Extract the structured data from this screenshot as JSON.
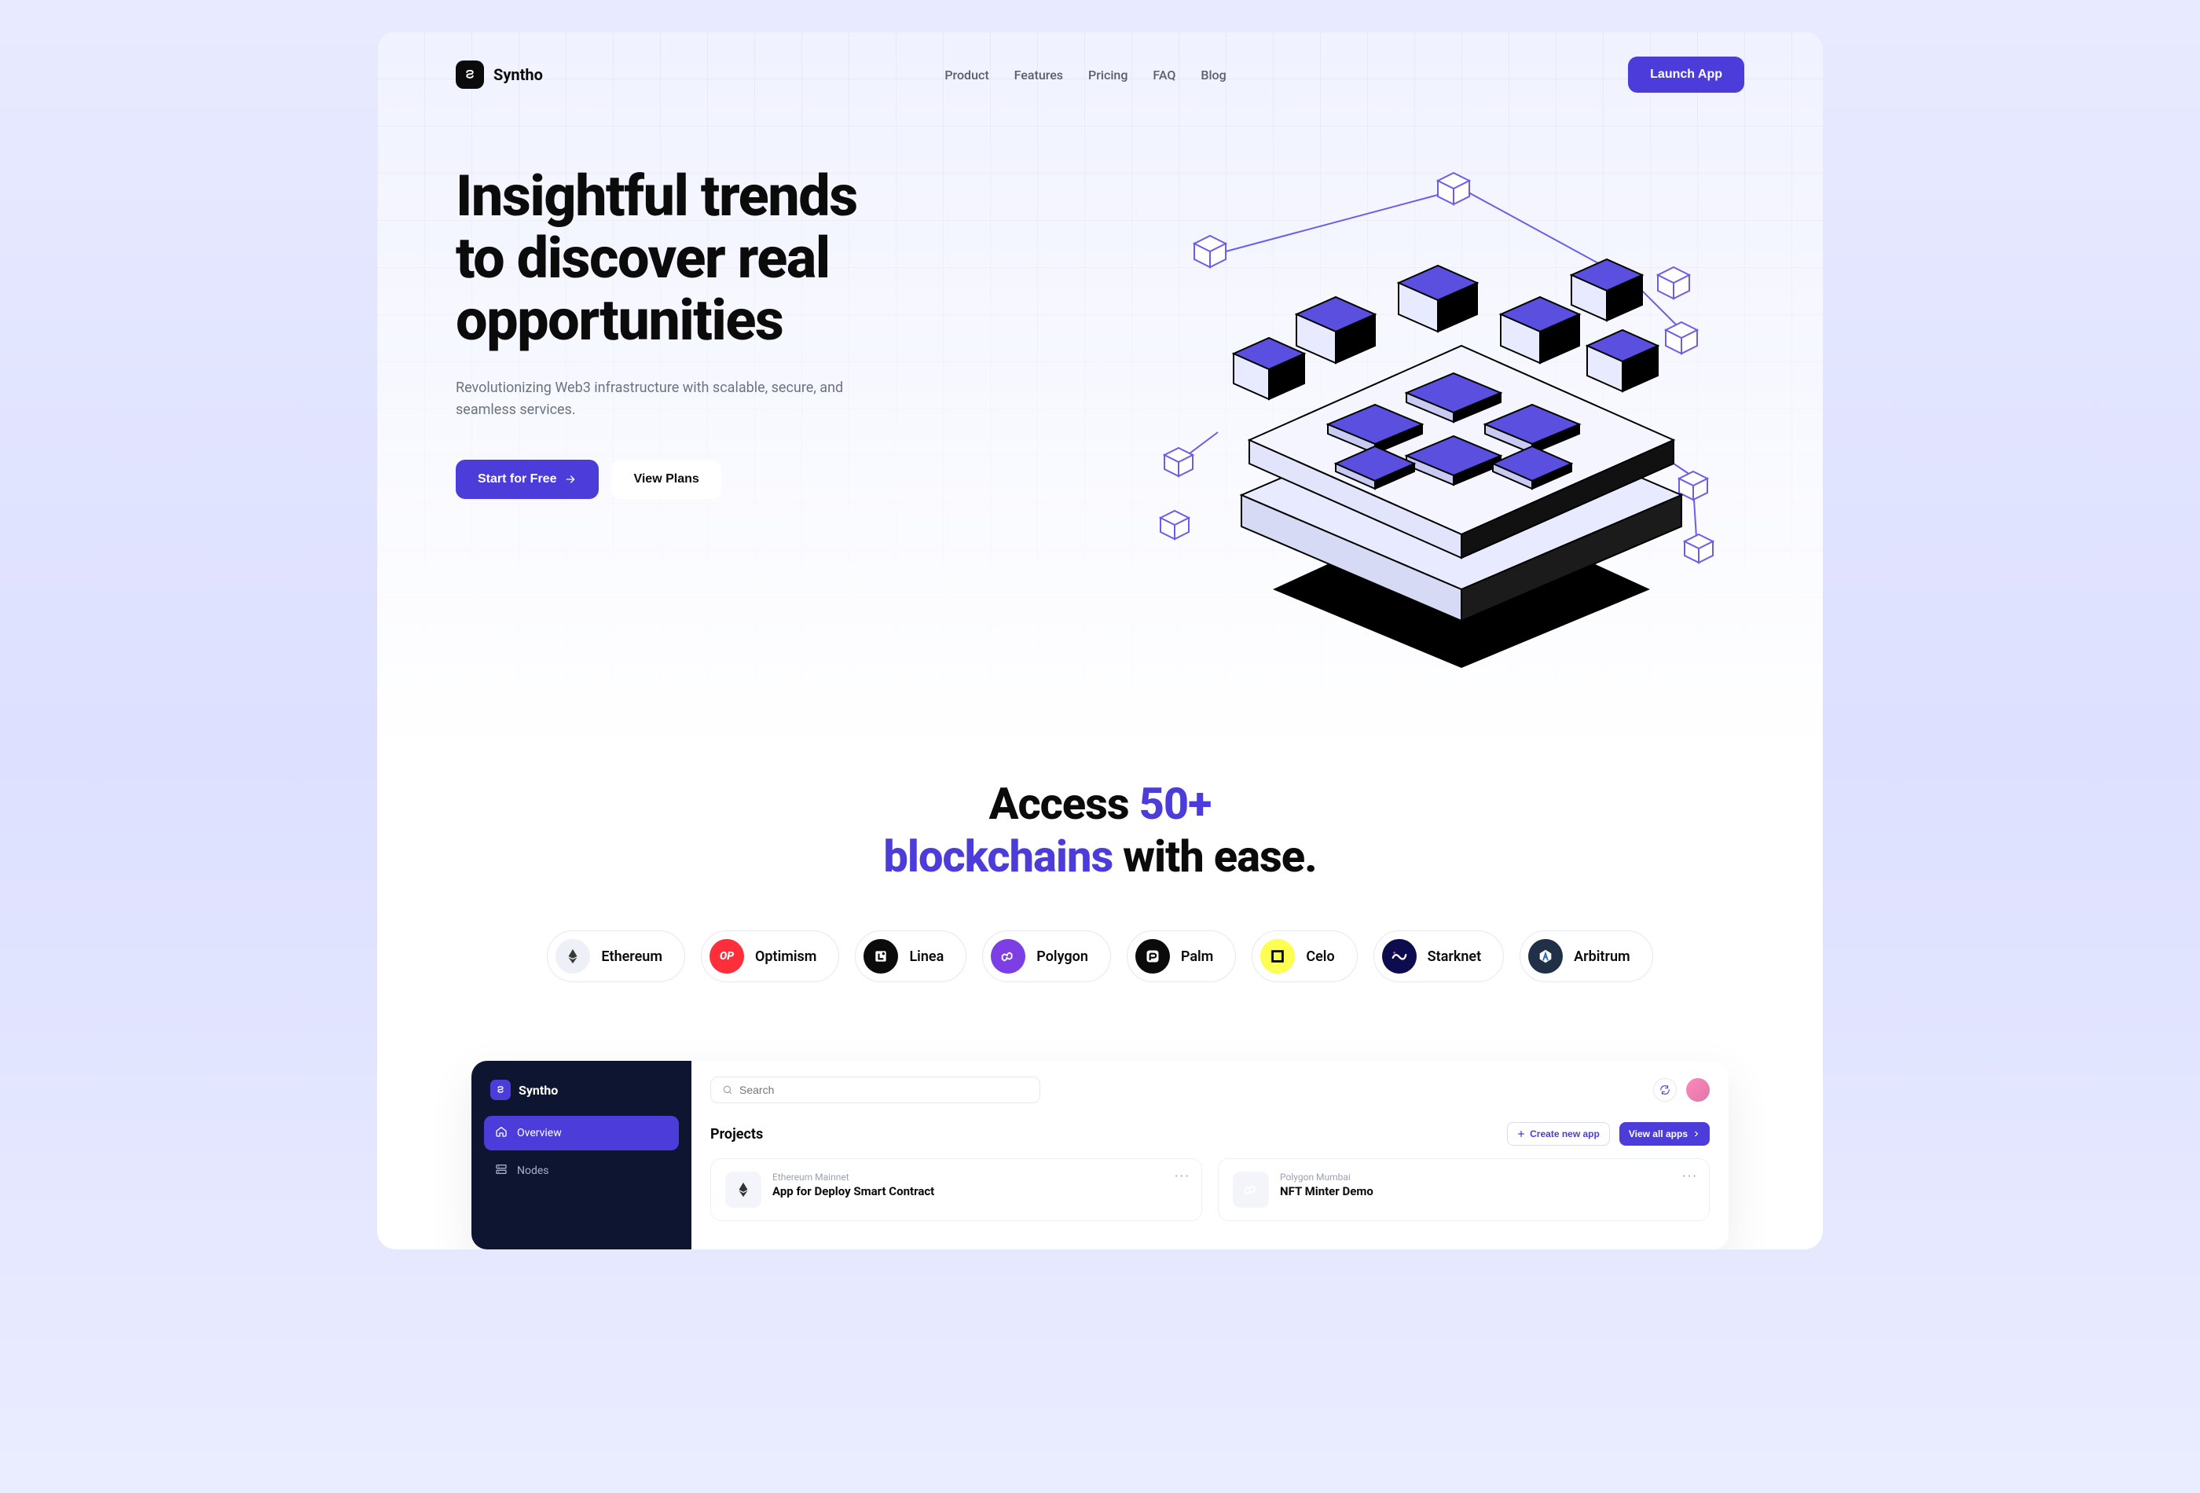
{
  "brand": {
    "name": "Syntho"
  },
  "nav": {
    "items": [
      "Product",
      "Features",
      "Pricing",
      "FAQ",
      "Blog"
    ]
  },
  "header": {
    "launch": "Launch App"
  },
  "hero": {
    "title_l1": "Insightful trends",
    "title_l2": "to discover real",
    "title_l3": "opportunities",
    "subtitle": "Revolutionizing Web3 infrastructure with scalable, secure, and seamless services.",
    "cta_primary": "Start for Free",
    "cta_secondary": "View Plans"
  },
  "access": {
    "pre": "Access ",
    "accent1": "50+",
    "br": " ",
    "accent2": "blockchains",
    "post": " with ease."
  },
  "chains": [
    {
      "name": "Ethereum",
      "bg": "#edf0f7",
      "fg": "#3a3a3a",
      "glyph": "eth"
    },
    {
      "name": "Optimism",
      "bg": "#ff2e3b",
      "fg": "#ffffff",
      "glyph": "op"
    },
    {
      "name": "Linea",
      "bg": "#0b0b0b",
      "fg": "#ffffff",
      "glyph": "linea"
    },
    {
      "name": "Polygon",
      "bg": "#7b3fe4",
      "fg": "#ffffff",
      "glyph": "polygon"
    },
    {
      "name": "Palm",
      "bg": "#0b0b0b",
      "fg": "#ffffff",
      "glyph": "palm"
    },
    {
      "name": "Celo",
      "bg": "#fcff52",
      "fg": "#0b0b0b",
      "glyph": "celo"
    },
    {
      "name": "Starknet",
      "bg": "#0c0c4f",
      "fg": "#ffffff",
      "glyph": "starknet"
    },
    {
      "name": "Arbitrum",
      "bg": "#203147",
      "fg": "#ffffff",
      "glyph": "arbitrum"
    }
  ],
  "dashboard": {
    "brand": "Syntho",
    "sidebar": [
      {
        "label": "Overview",
        "active": true,
        "icon": "home"
      },
      {
        "label": "Nodes",
        "active": false,
        "icon": "nodes"
      }
    ],
    "search_placeholder": "Search",
    "section_title": "Projects",
    "create_btn": "Create new app",
    "viewall_btn": "View all apps",
    "projects": [
      {
        "network": "Ethereum Mainnet",
        "title": "App for Deploy Smart Contract",
        "glyph": "eth"
      },
      {
        "network": "Polygon  Mumbai",
        "title": "NFT Minter Demo",
        "glyph": "polygon"
      }
    ]
  }
}
